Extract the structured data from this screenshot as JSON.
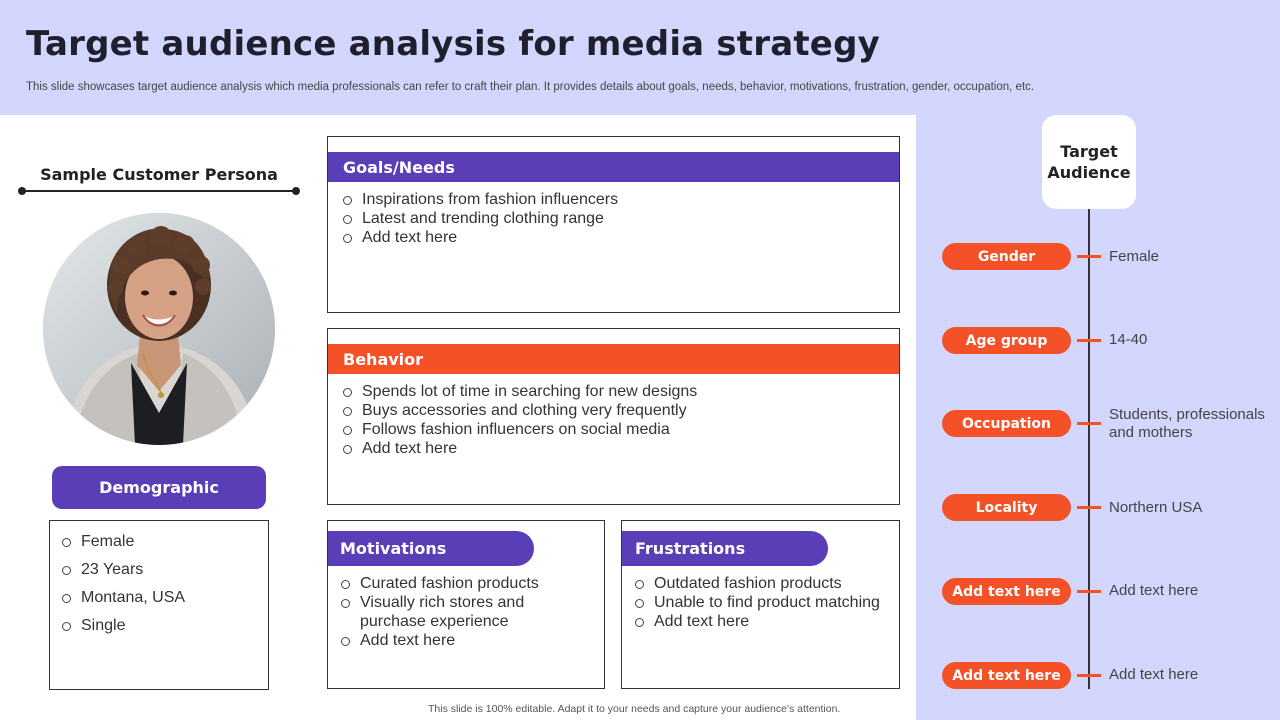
{
  "header": {
    "title": "Target audience analysis for media strategy",
    "subtitle": "This slide showcases target audience analysis which media professionals can refer to craft their plan. It provides details about goals, needs, behavior, motivations, frustration, gender, occupation, etc."
  },
  "persona": {
    "title": "Sample Customer Persona",
    "demographic_label": "Demographic",
    "demographic_items": [
      "Female",
      "23 Years",
      "Montana, USA",
      "Single"
    ]
  },
  "goals": {
    "title": "Goals/Needs",
    "items": [
      "Inspirations from fashion influencers",
      "Latest and trending clothing range",
      "Add text here"
    ]
  },
  "behavior": {
    "title": "Behavior",
    "items": [
      "Spends lot of time in searching for new designs",
      "Buys accessories and clothing very frequently",
      "Follows fashion influencers  on social media",
      "Add text here"
    ]
  },
  "motivations": {
    "title": "Motivations",
    "items": [
      "Curated fashion products",
      "Visually rich stores and purchase experience",
      "Add text here"
    ]
  },
  "frustrations": {
    "title": "Frustrations",
    "items": [
      "Outdated fashion products",
      "Unable to find product matching",
      "Add text here"
    ]
  },
  "target_audience": {
    "title_line1": "Target",
    "title_line2": "Audience",
    "rows": [
      {
        "label": "Gender",
        "value": "Female"
      },
      {
        "label": "Age group",
        "value": "14-40"
      },
      {
        "label": "Occupation",
        "value": "Students, professionals and mothers"
      },
      {
        "label": "Locality",
        "value": "Northern USA"
      },
      {
        "label": "Add text here",
        "value": "Add text here"
      },
      {
        "label": "Add text here",
        "value": "Add text here"
      }
    ]
  },
  "footer": {
    "text": "This slide is 100% editable.  Adapt it to your needs and capture your audience's attention."
  },
  "colors": {
    "purple": "#5a3eb8",
    "orange": "#f55128",
    "lavender": "#d3d7fd"
  }
}
